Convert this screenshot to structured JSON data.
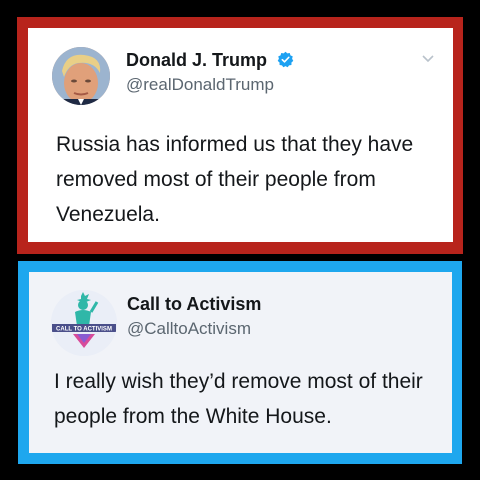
{
  "tweets": [
    {
      "display_name": "Donald J. Trump",
      "handle": "@realDonaldTrump",
      "verified": true,
      "text": "Russia has informed us that they have removed most of their people from Venezuela.",
      "frame_color": "#b8241c",
      "card_color": "#ffffff"
    },
    {
      "display_name": "Call to Activism",
      "handle": "@CalltoActivism",
      "verified": false,
      "avatar_label": "CALL TO ACTIVISM",
      "text": "I really wish they’d remove most of their people from the White House.",
      "frame_color": "#1ea7ee",
      "card_color": "#f1f3f8"
    }
  ],
  "icons": {
    "verified": "verified-badge-icon",
    "caret": "chevron-down-icon"
  }
}
